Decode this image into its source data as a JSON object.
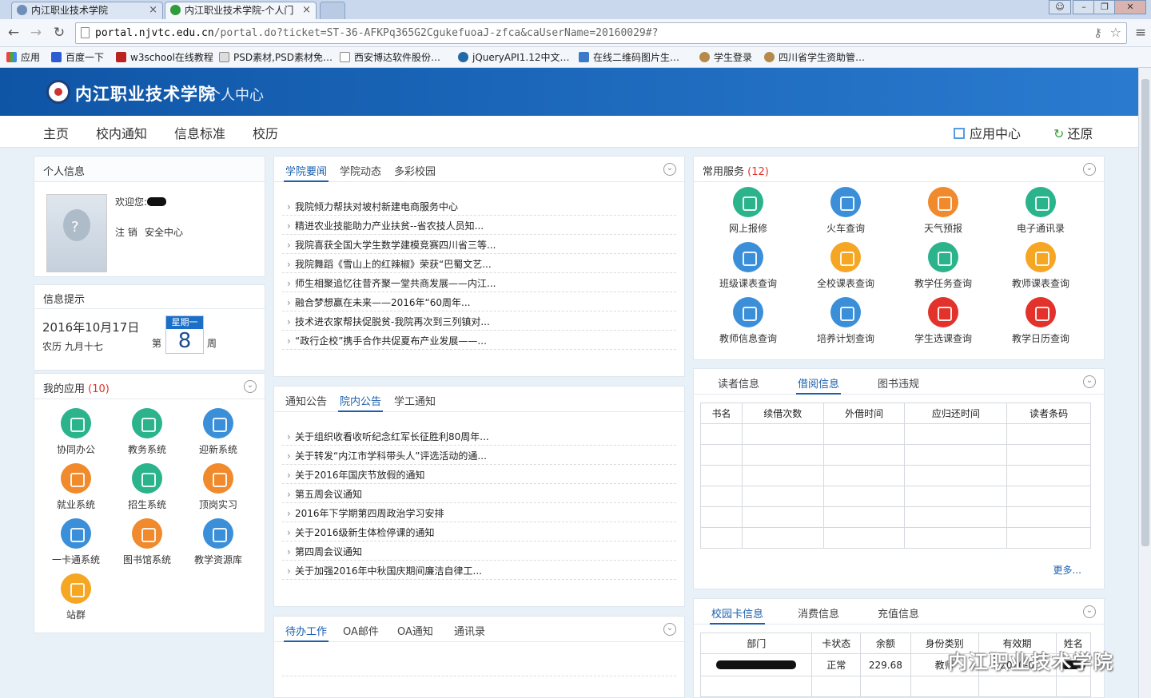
{
  "browser": {
    "tabs": [
      {
        "title": "内江职业技术学院",
        "active": false
      },
      {
        "title": "内江职业技术学院-个人门",
        "active": true
      }
    ],
    "url_host": "portal.njvtc.edu.cn",
    "url_rest": "/portal.do?ticket=ST-36-AFKPq365G2CgukefuoaJ-zfca&caUserName=20160029#?",
    "bookmarks": [
      "应用",
      "百度一下",
      "w3school在线教程",
      "PSD素材,PSD素材免…",
      "西安博达软件股份…",
      "jQueryAPI1.12中文…",
      "在线二维码图片生…",
      "学生登录",
      "四川省学生资助管…"
    ]
  },
  "header": {
    "school": "内江职业技术学院",
    "sub": "个人中心"
  },
  "nav": {
    "items": [
      "主页",
      "校内通知",
      "信息标准",
      "校历"
    ],
    "app_center": "应用中心",
    "restore": "还原"
  },
  "profile": {
    "title": "个人信息",
    "welcome": "欢迎您:",
    "logout": "注 销",
    "security": "安全中心"
  },
  "tips": {
    "title": "信息提示",
    "date": "2016年10月17日",
    "lunar": "农历 九月十七",
    "weekday": "星期一",
    "week_prefix": "第",
    "week_num": "8",
    "week_suffix": "周"
  },
  "apps": {
    "title": "我的应用",
    "count": "(10)",
    "items": [
      {
        "label": "协同办公",
        "color": "#2bb38c"
      },
      {
        "label": "教务系统",
        "color": "#2bb38c"
      },
      {
        "label": "迎新系统",
        "color": "#3b8fd9"
      },
      {
        "label": "就业系统",
        "color": "#f08a2c"
      },
      {
        "label": "招生系统",
        "color": "#2bb38c"
      },
      {
        "label": "顶岗实习",
        "color": "#f08a2c"
      },
      {
        "label": "一卡通系统",
        "color": "#3b8fd9"
      },
      {
        "label": "图书馆系统",
        "color": "#f08a2c"
      },
      {
        "label": "教学资源库",
        "color": "#3b8fd9"
      },
      {
        "label": "站群",
        "color": "#f5a623"
      }
    ]
  },
  "news1": {
    "tabs": [
      "学院要闻",
      "学院动态",
      "多彩校园"
    ],
    "items": [
      "我院倾力帮扶对坡村新建电商服务中心",
      "精进农业技能助力产业扶贫--省农技人员知...",
      "我院喜获全国大学生数学建模竞赛四川省三等...",
      "我院舞蹈《雪山上的红辣椒》荣获“巴蜀文艺...",
      "师生相聚追忆往昔齐聚一堂共商发展——内江...",
      "融合梦想赢在未来——2016年“60周年...",
      "技术进农家帮扶促脱贫-我院再次到三列镇对...",
      "“政行企校”携手合作共促夏布产业发展——..."
    ]
  },
  "news2": {
    "tabs": [
      "通知公告",
      "院内公告",
      "学工通知"
    ],
    "items": [
      "关于组织收看收听纪念红军长征胜利80周年...",
      "关于转发“内江市学科带头人”评选活动的通...",
      "关于2016年国庆节放假的通知",
      "第五周会议通知",
      "2016年下学期第四周政治学习安排",
      "关于2016级新生体检停课的通知",
      "第四周会议通知",
      "关于加强2016年中秋国庆期间廉洁自律工..."
    ]
  },
  "oa": {
    "tabs": [
      "待办工作",
      "OA邮件",
      "OA通知",
      "通讯录"
    ]
  },
  "services": {
    "title": "常用服务",
    "count": "(12)",
    "items": [
      {
        "label": "网上报修",
        "color": "#2bb38c"
      },
      {
        "label": "火车查询",
        "color": "#3b8fd9"
      },
      {
        "label": "天气预报",
        "color": "#f08a2c"
      },
      {
        "label": "电子通讯录",
        "color": "#2bb38c"
      },
      {
        "label": "班级课表查询",
        "color": "#3b8fd9"
      },
      {
        "label": "全校课表查询",
        "color": "#f5a623"
      },
      {
        "label": "教学任务查询",
        "color": "#2bb38c"
      },
      {
        "label": "教师课表查询",
        "color": "#f5a623"
      },
      {
        "label": "教师信息查询",
        "color": "#3b8fd9"
      },
      {
        "label": "培养计划查询",
        "color": "#3b8fd9"
      },
      {
        "label": "学生选课查询",
        "color": "#e2322b"
      },
      {
        "label": "教学日历查询",
        "color": "#e2322b"
      }
    ]
  },
  "library": {
    "tabs": [
      "读者信息",
      "借阅信息",
      "图书违规"
    ],
    "columns": [
      "书名",
      "续借次数",
      "外借时间",
      "应归还时间",
      "读者条码"
    ],
    "more": "更多..."
  },
  "card": {
    "tabs": [
      "校园卡信息",
      "消费信息",
      "充值信息"
    ],
    "columns": [
      "部门",
      "卡状态",
      "余额",
      "身份类别",
      "有效期",
      "姓名"
    ],
    "row": {
      "status": "正常",
      "balance": "229.68",
      "type": "教师",
      "valid": "2020-0"
    }
  },
  "watermark": "内江职业技术学院"
}
